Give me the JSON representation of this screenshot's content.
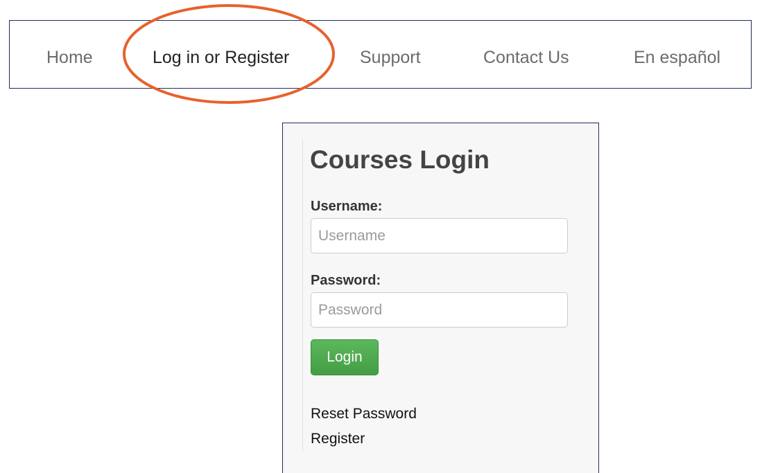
{
  "nav": {
    "items": [
      {
        "label": "Home"
      },
      {
        "label": "Log in or Register"
      },
      {
        "label": "Support"
      },
      {
        "label": "Contact Us"
      },
      {
        "label": "En español"
      }
    ],
    "active_index": 1
  },
  "annotation": {
    "color": "#e8612c"
  },
  "login": {
    "title": "Courses Login",
    "username_label": "Username:",
    "username_placeholder": "Username",
    "username_value": "",
    "password_label": "Password:",
    "password_placeholder": "Password",
    "password_value": "",
    "submit_label": "Login",
    "reset_password_link": "Reset Password",
    "register_link": "Register"
  },
  "colors": {
    "frame_border": "#1f2d5a",
    "button_green": "#5cb85c",
    "panel_background": "#f7f7f7"
  }
}
